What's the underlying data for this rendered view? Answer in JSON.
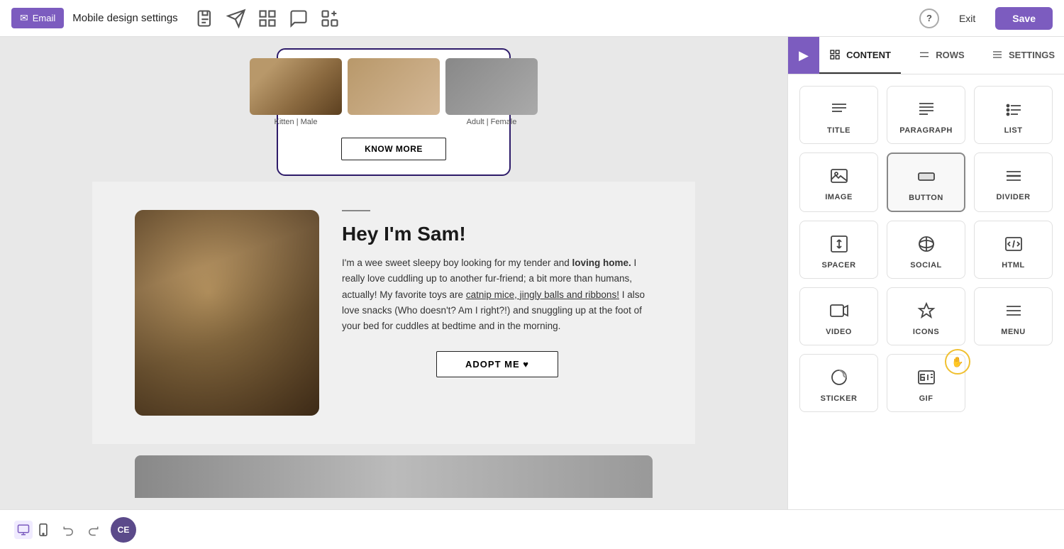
{
  "topbar": {
    "email_label": "Email",
    "title": "Mobile design settings",
    "exit_label": "Exit",
    "save_label": "Save",
    "help_label": "?"
  },
  "bottombar": {
    "avatar_label": "CE"
  },
  "panel": {
    "toggle_icon": "▶",
    "tabs": [
      {
        "id": "content",
        "label": "CONTENT",
        "active": true
      },
      {
        "id": "rows",
        "label": "ROWS",
        "active": false
      },
      {
        "id": "settings",
        "label": "SETTINGS",
        "active": false
      }
    ],
    "grid_items": [
      {
        "id": "title",
        "label": "TITLE"
      },
      {
        "id": "paragraph",
        "label": "PARAGRAPH"
      },
      {
        "id": "list",
        "label": "LIST"
      },
      {
        "id": "image",
        "label": "IMAGE"
      },
      {
        "id": "button",
        "label": "BUTTON"
      },
      {
        "id": "divider",
        "label": "DIVIDER"
      },
      {
        "id": "spacer",
        "label": "SPACER"
      },
      {
        "id": "social",
        "label": "SOCIAL"
      },
      {
        "id": "html",
        "label": "HTML"
      },
      {
        "id": "video",
        "label": "VIDEO"
      },
      {
        "id": "icons",
        "label": "ICONS"
      },
      {
        "id": "menu",
        "label": "MENU"
      },
      {
        "id": "sticker",
        "label": "STICKER"
      },
      {
        "id": "gif",
        "label": "GIF"
      }
    ]
  },
  "canvas": {
    "cats": [
      {
        "label": "Kitten | Male"
      },
      {
        "label": ""
      },
      {
        "label": "Adult | Female"
      }
    ],
    "know_more_label": "KNOW MORE",
    "sam": {
      "title": "Hey I'm Sam!",
      "text_1": "I'm a wee sweet sleepy boy looking for my tender and ",
      "text_bold": "loving home.",
      "text_2": " I really love cuddling up to another fur-friend; a bit more than humans, actually! My favorite toys are ",
      "text_link": "catnip mice, jingly balls and ribbons!",
      "text_3": " I also love snacks (Who doesn't? Am I right?!) and snuggling up at the foot of your bed for cuddles at bedtime and in the morning.",
      "adopt_label": "ADOPT ME ♥"
    }
  }
}
